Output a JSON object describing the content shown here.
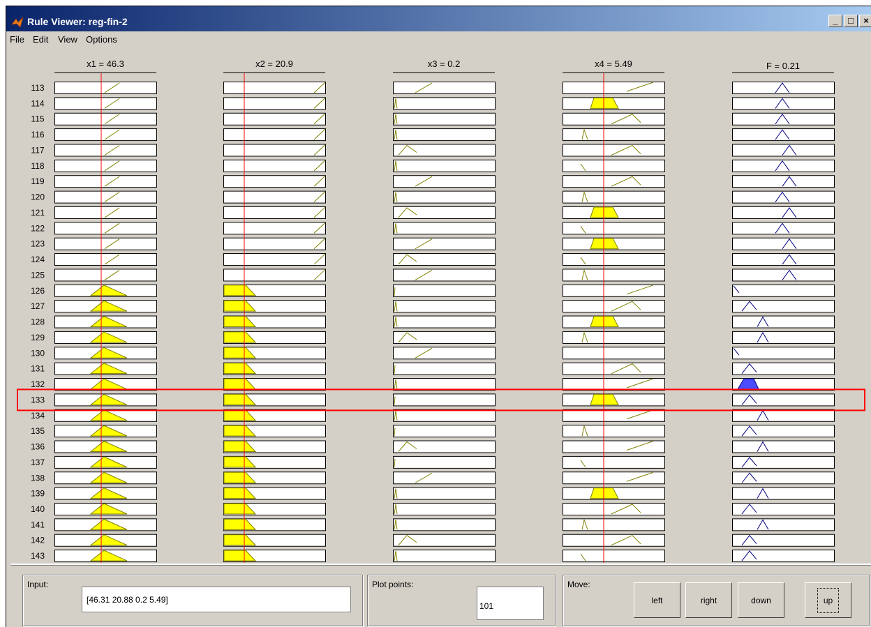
{
  "window": {
    "title": "Rule Viewer: reg-fin-2"
  },
  "menu": [
    "File",
    "Edit",
    "View",
    "Options"
  ],
  "headers": [
    "x1 = 46.3",
    "x2 = 20.9",
    "x3 = 0.2",
    "x4 = 5.49",
    "F = 0.21"
  ],
  "rules": [
    "113",
    "114",
    "115",
    "116",
    "117",
    "118",
    "119",
    "120",
    "121",
    "122",
    "123",
    "124",
    "125",
    "126",
    "127",
    "128",
    "129",
    "130",
    "131",
    "132",
    "133",
    "134",
    "135",
    "136",
    "137",
    "138",
    "139",
    "140",
    "141",
    "142",
    "143"
  ],
  "highlighted_rule": "133",
  "inputs": {
    "x1": 46.31,
    "x2": 20.88,
    "x3": 0.2,
    "x4": 5.49
  },
  "colors": {
    "fill_yellow": "#ffff00",
    "fill_blue": "#4b4bff",
    "line_olive": "#808000",
    "line_navy": "#000080",
    "indicator_red": "#ff0000",
    "title_blue": "#0a246a"
  },
  "bottom": {
    "input_label": "Input:",
    "input_value": "[46.31 20.88 0.2 5.49]",
    "plot_label": "Plot points:",
    "plot_value": "101",
    "move_label": "Move:",
    "buttons": {
      "left": "left",
      "right": "right",
      "down": "down",
      "up": "up"
    }
  },
  "icons": {
    "app": "matlab-fuzzy-icon",
    "minimize": "minimize-icon",
    "maximize": "maximize-icon",
    "close": "close-icon"
  }
}
